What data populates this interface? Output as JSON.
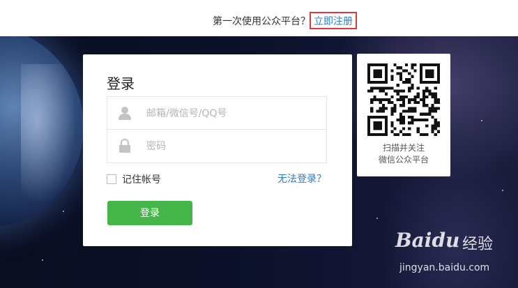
{
  "topbar": {
    "prompt_text": "第一次使用公众平台？",
    "register_link": "立即注册"
  },
  "login": {
    "title": "登录",
    "username_placeholder": "邮箱/微信号/QQ号",
    "password_placeholder": "密码",
    "remember_label": "记住帐号",
    "forgot_link": "无法登录？",
    "submit_label": "登录"
  },
  "qr": {
    "caption_line1": "扫描并关注",
    "caption_line2": "微信公众平台"
  },
  "watermark": {
    "logo_text": "Baidu",
    "logo_suffix": "经验",
    "url": "jingyan.baidu.com"
  },
  "colors": {
    "accent_green": "#44b549",
    "link_blue": "#2d7dc2",
    "highlight_red": "#e0373f"
  }
}
